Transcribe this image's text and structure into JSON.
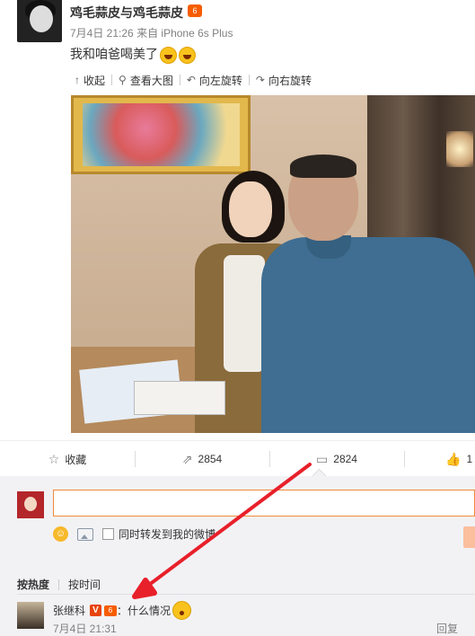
{
  "post": {
    "username": "鸡毛蒜皮与鸡毛蒜皮",
    "vip_badge": "6",
    "time": "7月4日 21:26",
    "source": "来自 iPhone 6s Plus",
    "text": "我和咱爸喝美了"
  },
  "toolbar": {
    "collapse": "收起",
    "view_large": "查看大图",
    "rotate_left": "向左旋转",
    "rotate_right": "向右旋转"
  },
  "actions": {
    "favorite": "收藏",
    "repost_count": "2854",
    "comment_count": "2824",
    "like_count": "1"
  },
  "comment_box": {
    "also_repost": "同时转发到我的微博"
  },
  "sort": {
    "by_hot": "按热度",
    "by_time": "按时间"
  },
  "comments": [
    {
      "name": "张继科",
      "verified": "V",
      "vip": "6",
      "text": "：什么情况",
      "time": "7月4日 21:31",
      "reply": "回复"
    }
  ],
  "colors": {
    "accent": "#f08a3c",
    "annotation_arrow": "#e8202a"
  }
}
